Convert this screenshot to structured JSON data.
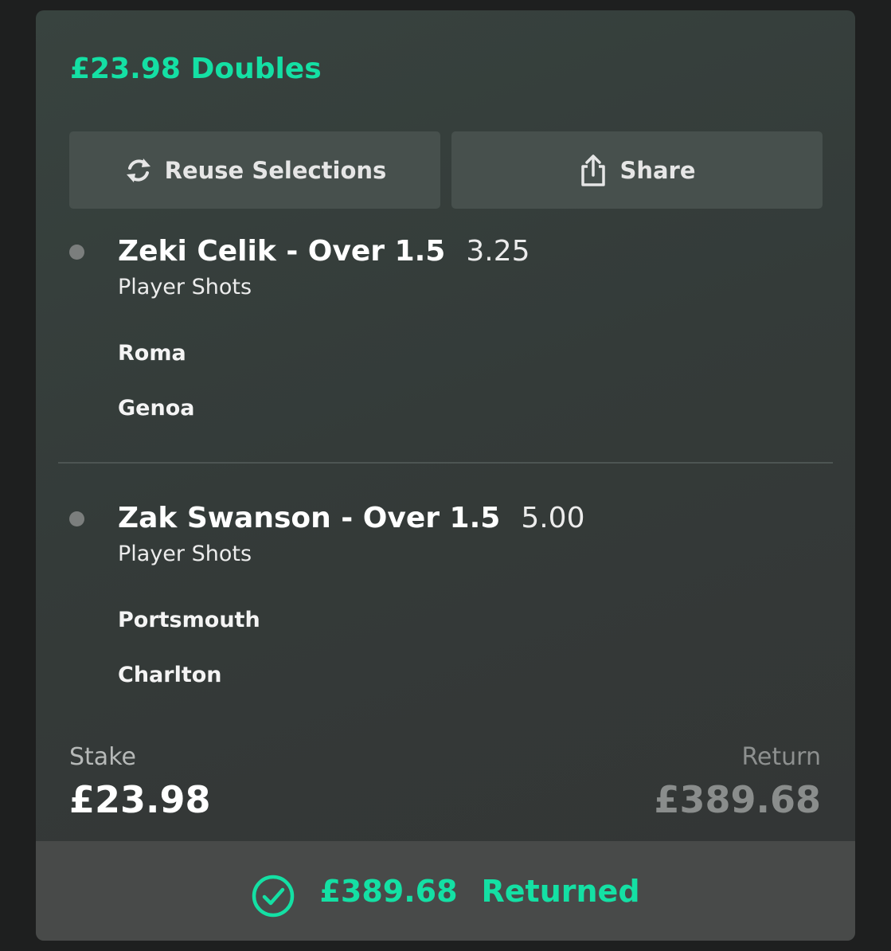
{
  "bet": {
    "title": "£23.98 Doubles"
  },
  "actions": {
    "reuse_label": "Reuse Selections",
    "share_label": "Share"
  },
  "selections": [
    {
      "name": "Zeki Celik - Over 1.5",
      "odds": "3.25",
      "market": "Player Shots",
      "teams": [
        "Roma",
        "Genoa"
      ]
    },
    {
      "name": "Zak Swanson - Over 1.5",
      "odds": "5.00",
      "market": "Player Shots",
      "teams": [
        "Portsmouth",
        "Charlton"
      ]
    }
  ],
  "summary": {
    "stake_label": "Stake",
    "stake_value": "£23.98",
    "return_label": "Return",
    "return_value": "£389.68"
  },
  "footer": {
    "amount": "£389.68",
    "status": "Returned"
  },
  "colors": {
    "accent": "#14e0a4",
    "card": "#363d3b",
    "button": "#47504d",
    "footer": "#484a49"
  },
  "icons": {
    "reuse": "refresh-icon",
    "share": "share-icon",
    "status": "check-circle-icon"
  }
}
